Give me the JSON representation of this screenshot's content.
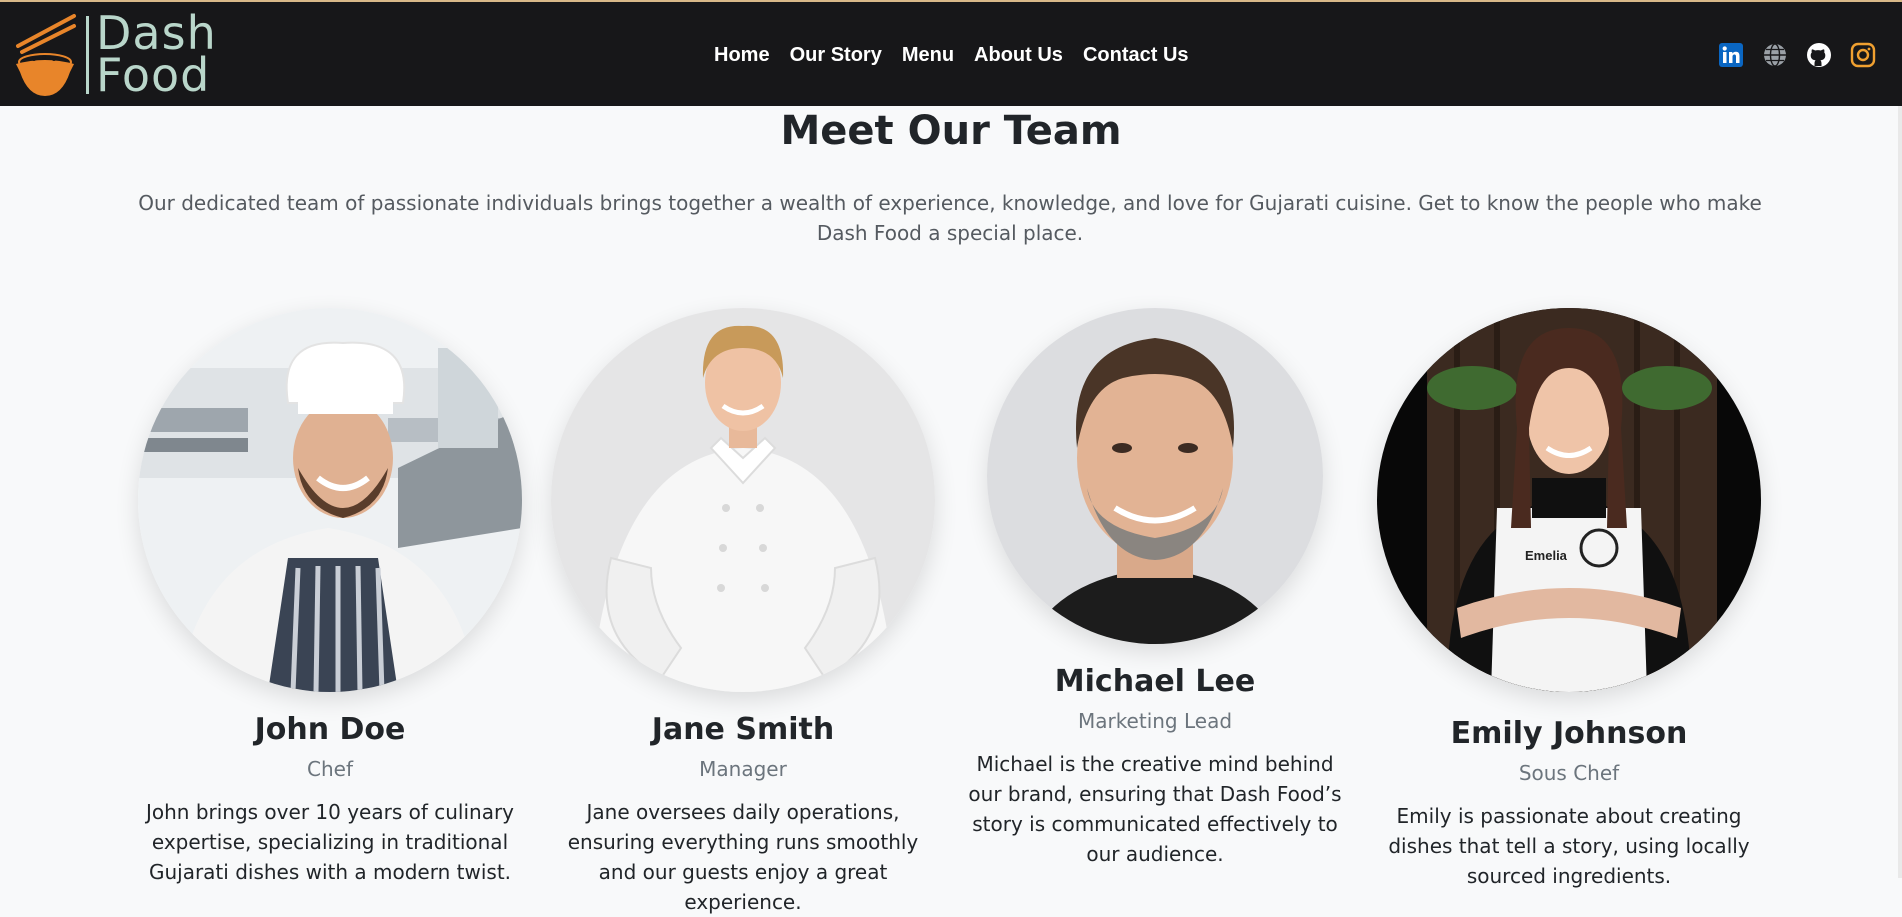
{
  "brand": {
    "line1": "Dash",
    "line2": "Food",
    "logo_color": "#e8852a",
    "text_color": "#b9d6ca"
  },
  "nav": {
    "items": [
      "Home",
      "Our Story",
      "Menu",
      "About Us",
      "Contact Us"
    ]
  },
  "social": [
    {
      "icon": "linkedin-icon",
      "color": "#0a66c2"
    },
    {
      "icon": "globe-icon",
      "color": "#9aa0a6"
    },
    {
      "icon": "github-icon",
      "color": "#ffffff"
    },
    {
      "icon": "instagram-icon",
      "color": "#f0a030"
    }
  ],
  "section": {
    "title": "Meet Our Team",
    "intro": "Our dedicated team of passionate individuals brings together a wealth of experience, knowledge, and love for Gujarati cuisine. Get to know the people who make Dash Food a special place."
  },
  "team": [
    {
      "name": "John Doe",
      "role": "Chef",
      "bio": "John brings over 10 years of culinary expertise, specializing in traditional Gujarati dishes with a modern twist."
    },
    {
      "name": "Jane Smith",
      "role": "Manager",
      "bio": "Jane oversees daily operations, ensuring everything runs smoothly and our guests enjoy a great experience."
    },
    {
      "name": "Michael Lee",
      "role": "Marketing Lead",
      "bio": "Michael is the creative mind behind our brand, ensuring that Dash Food’s story is communicated effectively to our audience."
    },
    {
      "name": "Emily Johnson",
      "role": "Sous Chef",
      "bio": "Emily is passionate about creating dishes that tell a story, using locally sourced ingredients."
    }
  ],
  "apron_label": "Emelia"
}
